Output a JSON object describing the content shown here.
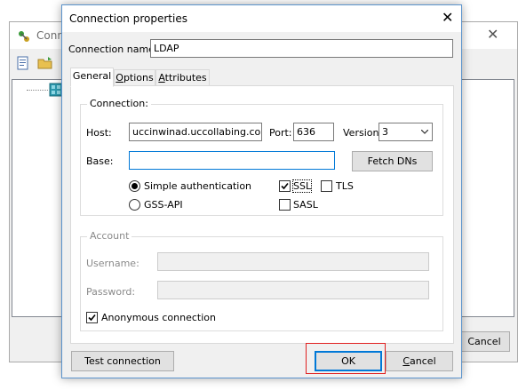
{
  "background_window": {
    "title": "Conn",
    "cancel_label": "Cancel"
  },
  "dialog": {
    "title": "Connection properties",
    "connection_name_label": "Connection name:",
    "connection_name_value": "LDAP",
    "tabs": [
      {
        "label": "General",
        "active": true
      },
      {
        "label": "Options",
        "active": false
      },
      {
        "label": "Attributes",
        "active": false
      }
    ],
    "connection_group": {
      "label": "Connection:",
      "host_label": "Host:",
      "host_value": "uccinwinad.uccollabing.com",
      "port_label": "Port:",
      "port_value": "636",
      "version_label": "Version:",
      "version_value": "3",
      "base_label": "Base:",
      "base_value": "",
      "fetch_dns_label": "Fetch DNs",
      "auth_simple_label": "Simple authentication",
      "auth_simple_checked": true,
      "auth_gss_label": "GSS-API",
      "auth_gss_checked": false,
      "ssl_label": "SSL",
      "ssl_checked": true,
      "tls_label": "TLS",
      "tls_checked": false,
      "sasl_label": "SASL",
      "sasl_checked": false
    },
    "account_group": {
      "label": "Account",
      "username_label": "Username:",
      "username_value": "",
      "password_label": "Password:",
      "password_value": "",
      "anonymous_label": "Anonymous connection",
      "anonymous_checked": true
    },
    "buttons": {
      "test_connection": "Test connection",
      "ok": "OK",
      "cancel": "Cancel"
    }
  },
  "colors": {
    "accent": "#0078d7",
    "highlight_box": "#e02020"
  }
}
